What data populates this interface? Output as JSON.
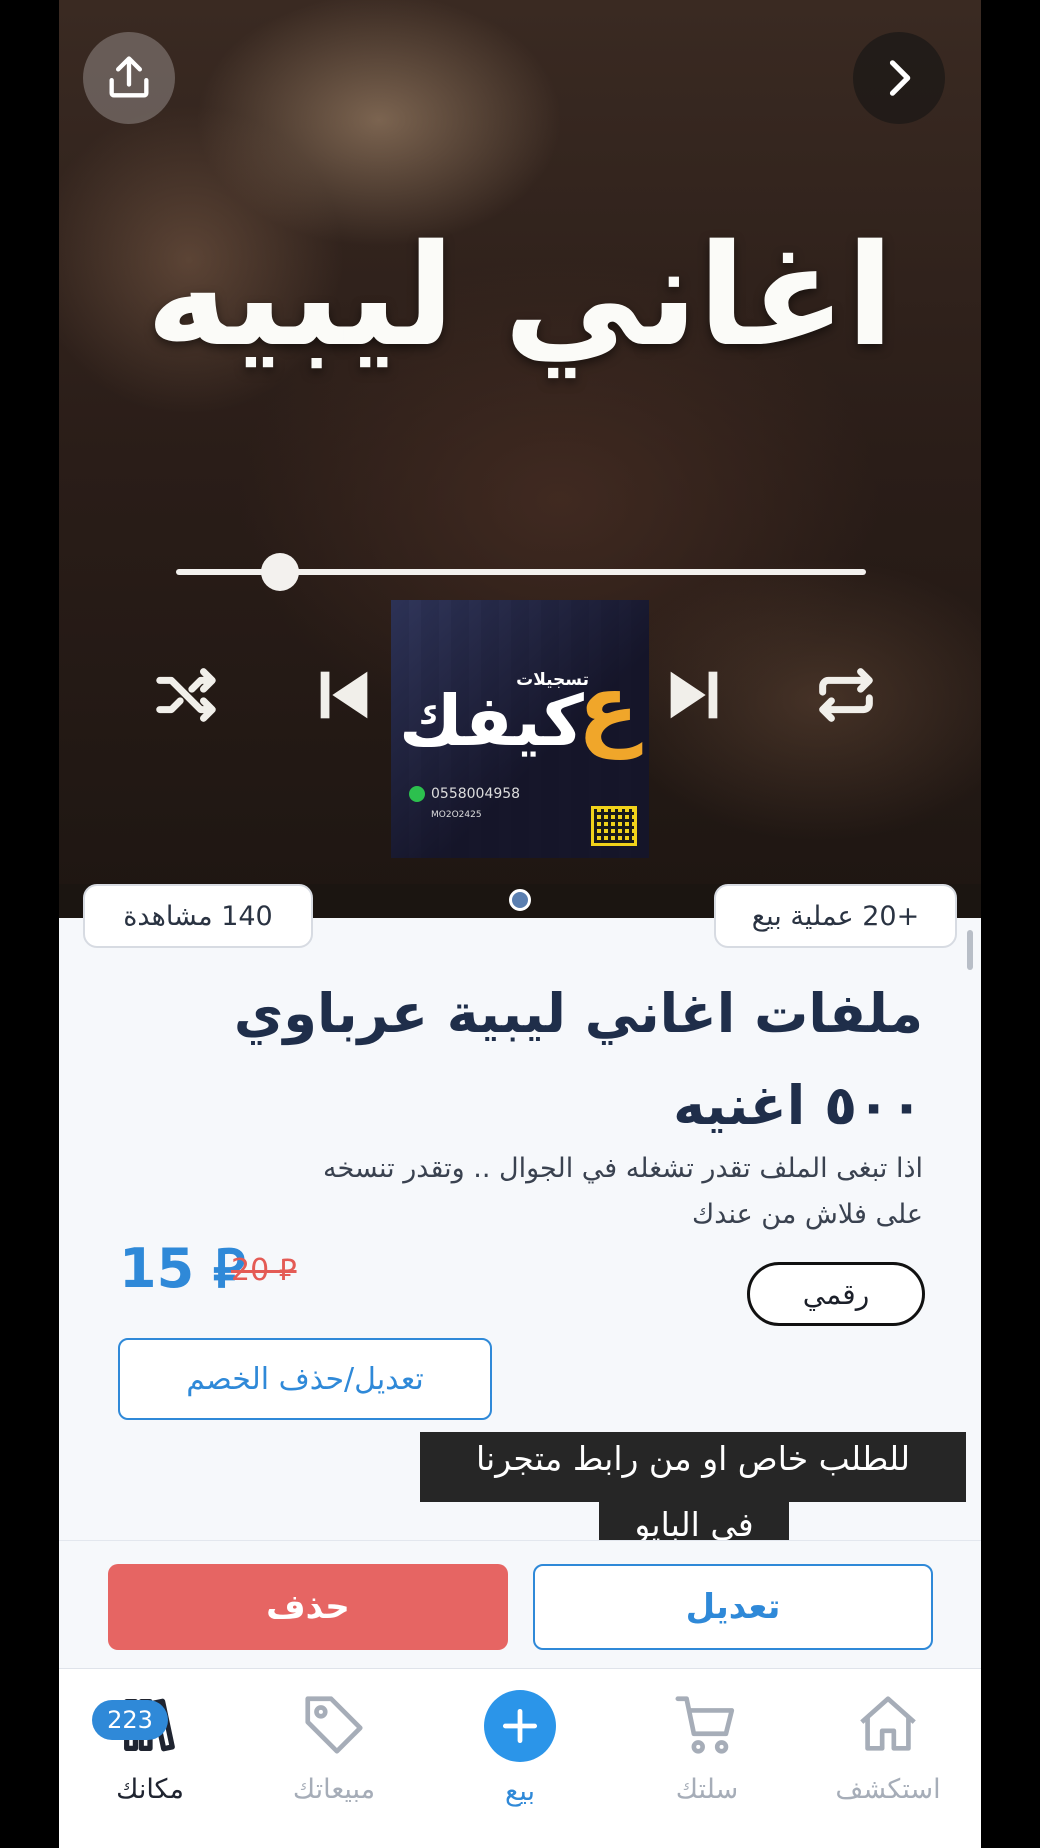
{
  "hero": {
    "title": "اغاني ليبيه",
    "logo": {
      "small_text": "تسجيلات",
      "main_text": "كيفك",
      "ain": "ع",
      "phone": "0558004958",
      "handle": "MO2O2425"
    }
  },
  "stats": {
    "sales": "+20 عملية بيع",
    "views": "140 مشاهدة"
  },
  "product": {
    "title": "ملفات اغاني ليبية عرباوي ٥٠٠ اغنيه",
    "description": "اذا تبغى الملف تقدر تشغله في الجوال .. وتقدر تنسخه على فلاش من عندك",
    "price_now": "15",
    "price_old": "20",
    "currency_symbol": "⃁",
    "type_chip": "رقمي",
    "discount_button": "تعديل/حذف الخصم"
  },
  "caption": {
    "line1": "للطلب خاص او من رابط متجرنا",
    "line2": "في البايو"
  },
  "actions": {
    "edit": "تعديل",
    "delete": "حذف"
  },
  "nav": {
    "items": [
      {
        "label": "استكشف",
        "icon": "home-icon"
      },
      {
        "label": "سلتك",
        "icon": "cart-icon"
      },
      {
        "label": "بيع",
        "icon": "plus-icon"
      },
      {
        "label": "مبيعاتك",
        "icon": "tag-icon"
      },
      {
        "label": "مكانك",
        "icon": "shelf-icon"
      }
    ],
    "badge_count": "223"
  },
  "colors": {
    "accent": "#2f89d8",
    "danger": "#e66563",
    "title": "#1f2e4a"
  }
}
